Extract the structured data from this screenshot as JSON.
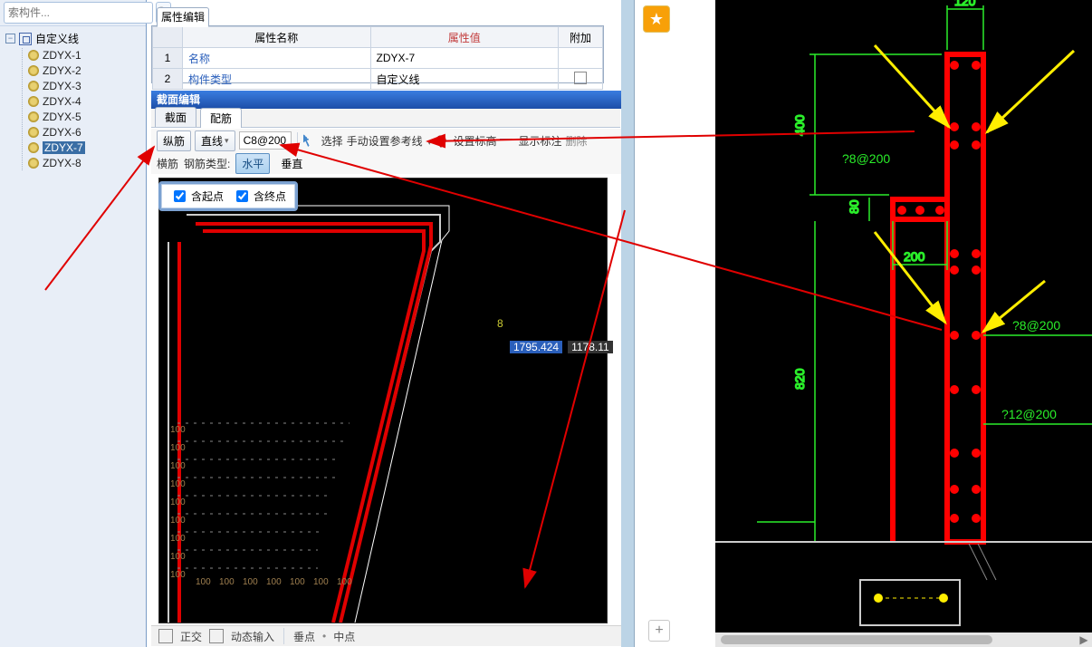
{
  "search": {
    "placeholder": "索构件..."
  },
  "tree": {
    "root_label": "自定义线",
    "items": [
      {
        "label": "ZDYX-1",
        "selected": false
      },
      {
        "label": "ZDYX-2",
        "selected": false
      },
      {
        "label": "ZDYX-3",
        "selected": false
      },
      {
        "label": "ZDYX-4",
        "selected": false
      },
      {
        "label": "ZDYX-5",
        "selected": false
      },
      {
        "label": "ZDYX-6",
        "selected": false
      },
      {
        "label": "ZDYX-7",
        "selected": true
      },
      {
        "label": "ZDYX-8",
        "selected": false
      }
    ]
  },
  "prop_editor": {
    "tab_label": "属性编辑",
    "headers": {
      "name": "属性名称",
      "value": "属性值",
      "extra": "附加"
    },
    "rows": [
      {
        "num": "1",
        "name": "名称",
        "value": "ZDYX-7",
        "checkbox": false
      },
      {
        "num": "2",
        "name": "构件类型",
        "value": "自定义线",
        "checkbox": true
      }
    ]
  },
  "section_editor": {
    "title": "截面编辑",
    "tabs": {
      "section": "截面",
      "rebar": "配筋"
    },
    "toolbar1": {
      "vertical_rebar": "纵筋",
      "straight_line": "直线",
      "spec": "C8@200",
      "select": "选择",
      "manual_refline": "手动设置参考线",
      "set_elevation": "设置标高",
      "show_dim": "显示标注",
      "delete": "删除"
    },
    "toolbar2": {
      "transverse_label": "横筋",
      "rebar_type_label": "钢筋类型:",
      "horizontal": "水平",
      "vertical": "垂直"
    },
    "checkbar": {
      "start": "含起点",
      "end": "含终点"
    },
    "canvas": {
      "label_8": "8",
      "coord_x": "1795.424",
      "coord_y": "1178.11",
      "grid_numbers": [
        "100",
        "100",
        "100",
        "100",
        "100",
        "100",
        "100",
        "100",
        "100",
        "100",
        "100",
        "100",
        "100",
        "100",
        "100",
        "100"
      ]
    }
  },
  "statusbar": {
    "ortho": "正交",
    "dynamic_input": "动态输入",
    "endpoint": "垂点",
    "midpoint": "中点"
  },
  "strip": {
    "star": "★",
    "plus": "+"
  },
  "right_view": {
    "dims": {
      "top_width": "120",
      "top_height": "400",
      "notch_top": "?8@200",
      "notch_height": "80",
      "notch_width": "200",
      "mid_annot": "?8@200",
      "mid_height": "820",
      "bottom_annot": "?12@200"
    }
  }
}
